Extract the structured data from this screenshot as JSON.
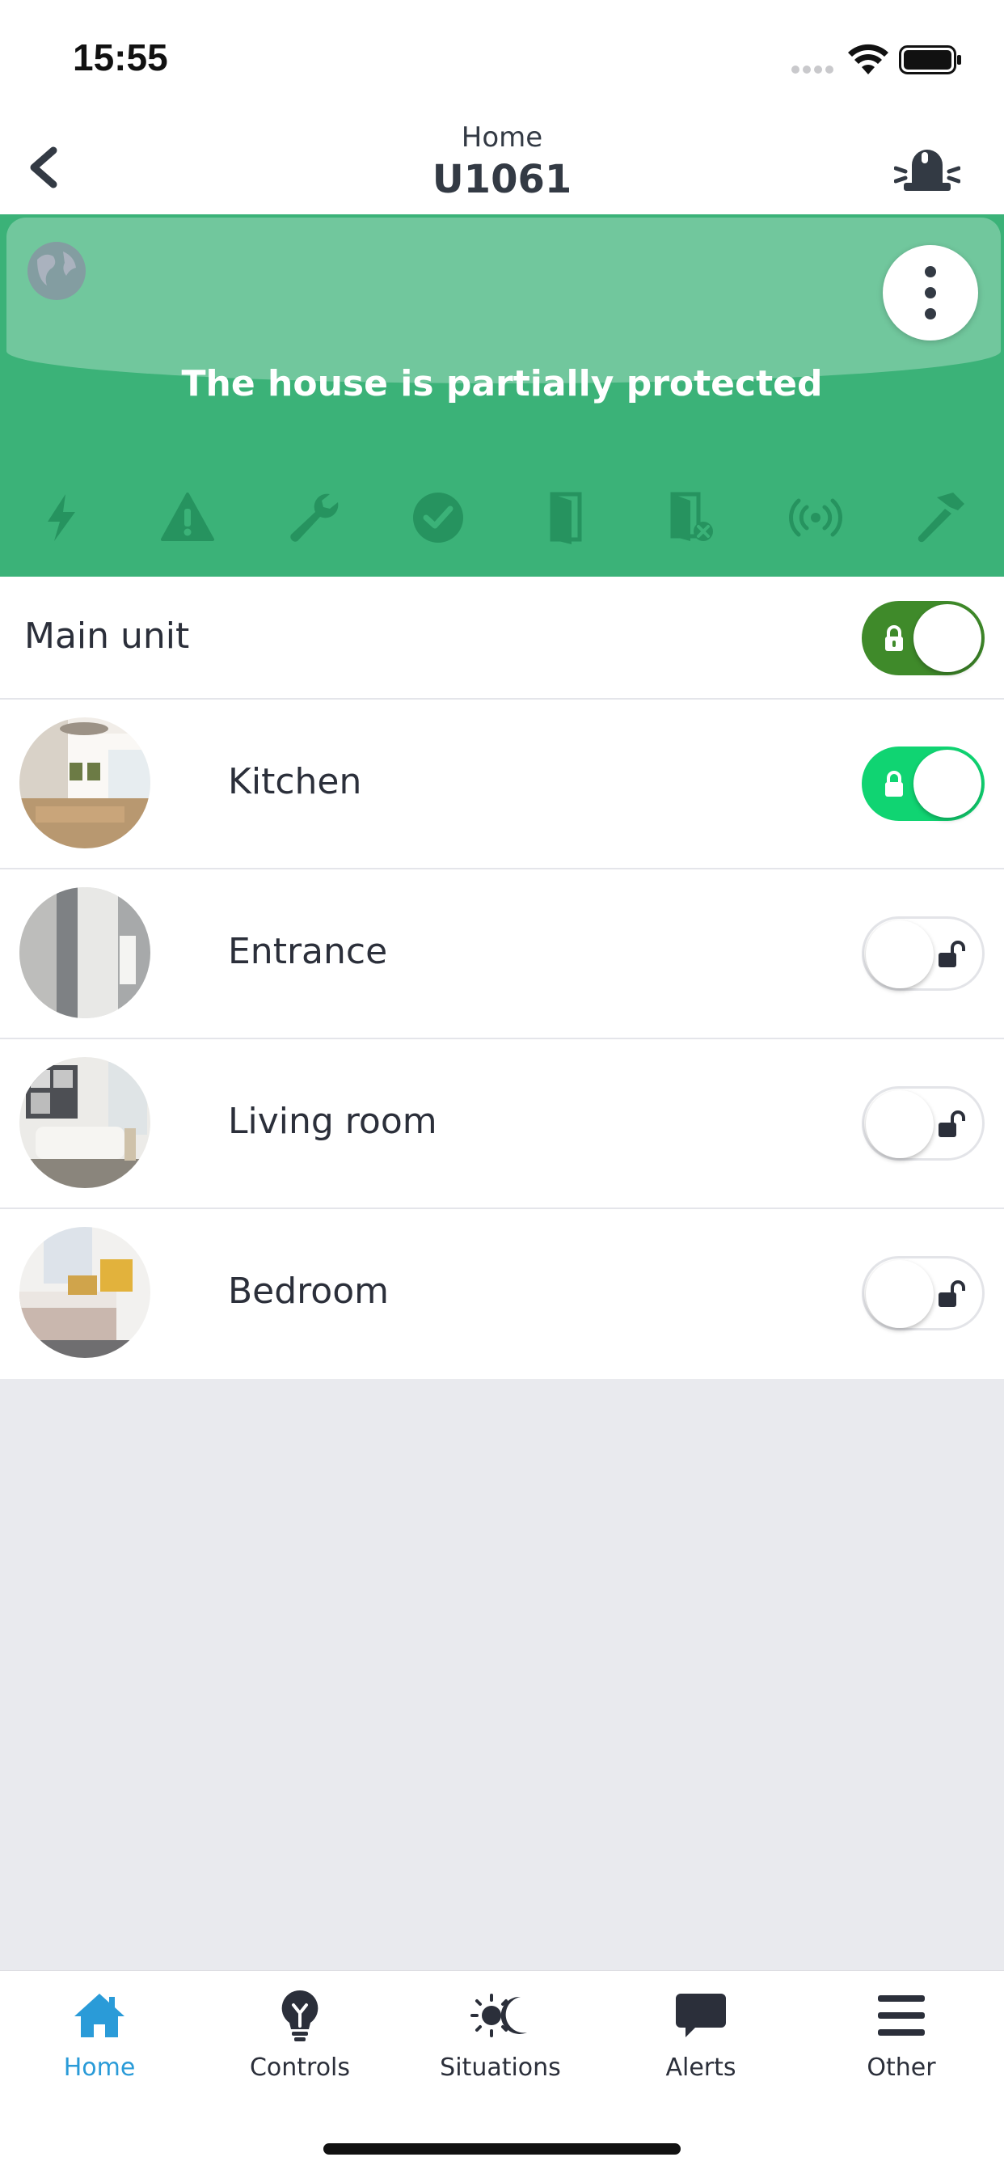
{
  "status_bar": {
    "time": "15:55"
  },
  "header": {
    "subtitle": "Home",
    "title": "U1061"
  },
  "banner": {
    "message": "The house is partially protected",
    "color": "#3bb278",
    "icons": [
      "bolt-icon",
      "warning-icon",
      "wrench-icon",
      "check-circle-icon",
      "door-icon",
      "door-error-icon",
      "signal-icon",
      "hammer-icon"
    ]
  },
  "main_unit": {
    "label": "Main unit",
    "armed": true,
    "toggle_color": "#3f8a2a"
  },
  "zones": [
    {
      "label": "Kitchen",
      "armed": true,
      "toggle_color": "#10d472"
    },
    {
      "label": "Entrance",
      "armed": false
    },
    {
      "label": "Living room",
      "armed": false
    },
    {
      "label": "Bedroom",
      "armed": false
    }
  ],
  "tabs": [
    {
      "label": "Home",
      "icon": "house-icon",
      "active": true
    },
    {
      "label": "Controls",
      "icon": "lightbulb-icon",
      "active": false
    },
    {
      "label": "Situations",
      "icon": "sun-moon-icon",
      "active": false
    },
    {
      "label": "Alerts",
      "icon": "chat-bubble-icon",
      "active": false
    },
    {
      "label": "Other",
      "icon": "hamburger-icon",
      "active": false
    }
  ],
  "colors": {
    "accent": "#2a9bd8",
    "text": "#2b2f3a",
    "background": "#e9eaee"
  }
}
